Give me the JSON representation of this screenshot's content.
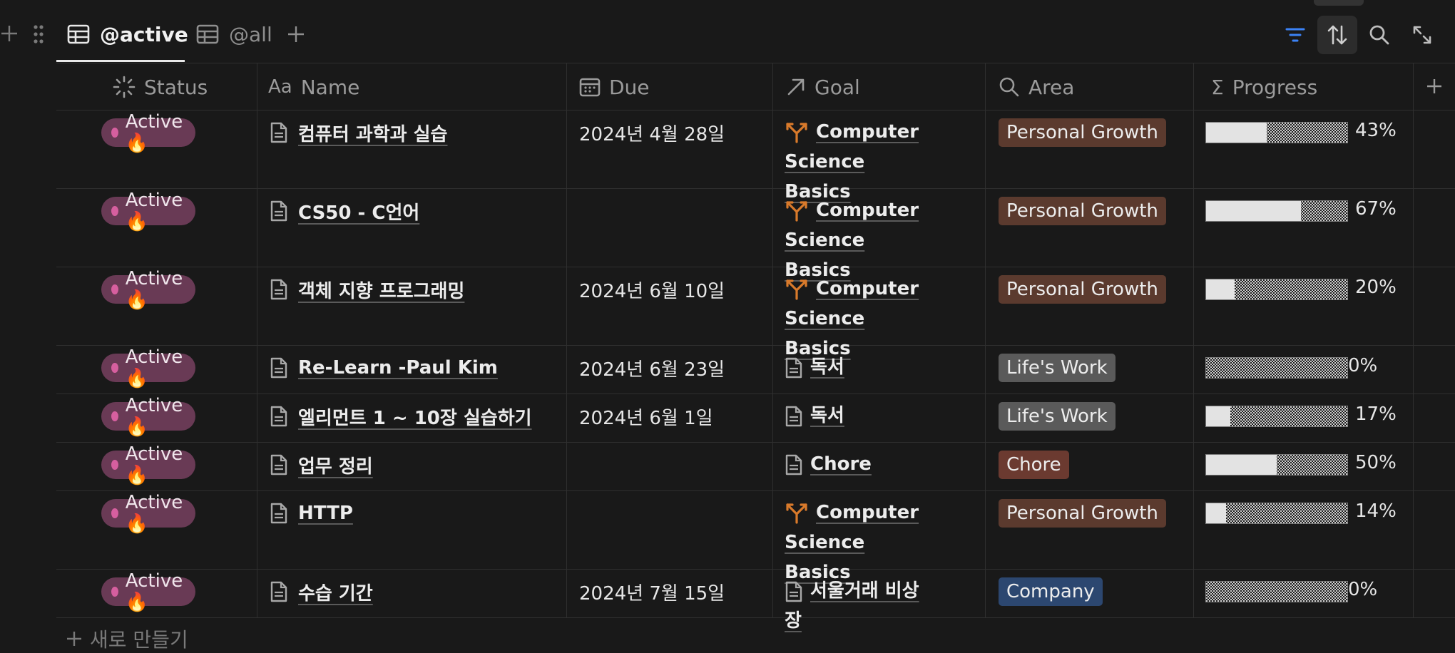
{
  "tabs": [
    {
      "label": "@active",
      "active": true
    },
    {
      "label": "@all",
      "active": false
    }
  ],
  "toolbar": {
    "filter_color": "#3b82f6"
  },
  "columns": [
    {
      "label": "Status",
      "icon": "status-icon"
    },
    {
      "label": "Name",
      "icon": "text-prop-icon",
      "icon_text": "Aa"
    },
    {
      "label": "Due",
      "icon": "calendar-icon"
    },
    {
      "label": "Goal",
      "icon": "relation-arrow-icon"
    },
    {
      "label": "Area",
      "icon": "search-icon"
    },
    {
      "label": "Progress",
      "icon": "sigma-icon",
      "icon_text": "Σ"
    }
  ],
  "status_label": "Active 🔥",
  "rows": [
    {
      "status": "Active 🔥",
      "name": "컴퓨터 과학과 실습",
      "due": "2024년 4월 28일",
      "goal": "Computer Science Basics",
      "goal_line1": "Computer",
      "goal_line2": "Science Basics",
      "goal_icon": "goal-icon",
      "area": "Personal Growth",
      "area_color": "#5b3a2e",
      "progress": 0.43,
      "progress_label": "43%"
    },
    {
      "status": "Active 🔥",
      "name": "CS50 - C언어",
      "due": "",
      "goal": "Computer Science Basics",
      "goal_line1": "Computer",
      "goal_line2": "Science Basics",
      "goal_icon": "goal-icon",
      "area": "Personal Growth",
      "area_color": "#5b3a2e",
      "progress": 0.67,
      "progress_label": "67%"
    },
    {
      "status": "Active 🔥",
      "name": "객체 지향 프로그래밍",
      "due": "2024년 6월 10일",
      "goal": "Computer Science Basics",
      "goal_line1": "Computer",
      "goal_line2": "Science Basics",
      "goal_icon": "goal-icon",
      "area": "Personal Growth",
      "area_color": "#5b3a2e",
      "progress": 0.2,
      "progress_label": "20%"
    },
    {
      "status": "Active 🔥",
      "name": "Re-Learn -Paul Kim",
      "due": "2024년 6월 23일",
      "goal": "독서",
      "goal_line1": "독서",
      "goal_line2": "",
      "goal_icon": "page-icon",
      "area": "Life's Work",
      "area_color": "#5a5a5a",
      "progress": 0.0,
      "progress_label": "0%"
    },
    {
      "status": "Active 🔥",
      "name": "엘리먼트 1 ~ 10장 실습하기",
      "due": "2024년 6월 1일",
      "goal": "독서",
      "goal_line1": "독서",
      "goal_line2": "",
      "goal_icon": "page-icon",
      "area": "Life's Work",
      "area_color": "#5a5a5a",
      "progress": 0.17,
      "progress_label": "17%"
    },
    {
      "status": "Active 🔥",
      "name": "업무 정리",
      "due": "",
      "goal": "Chore",
      "goal_line1": "Chore",
      "goal_line2": "",
      "goal_icon": "page-icon",
      "area": "Chore",
      "area_color": "#6b3a30",
      "progress": 0.5,
      "progress_label": "50%"
    },
    {
      "status": "Active 🔥",
      "name": "HTTP",
      "due": "",
      "goal": "Computer Science Basics",
      "goal_line1": "Computer",
      "goal_line2": "Science Basics",
      "goal_icon": "goal-icon",
      "area": "Personal Growth",
      "area_color": "#5b3a2e",
      "progress": 0.14,
      "progress_label": "14%"
    },
    {
      "status": "Active 🔥",
      "name": "수습 기간",
      "due": "2024년 7월 15일",
      "goal": "서울거래 비상장",
      "goal_line1": "서울거래 비상장",
      "goal_line2": "",
      "goal_icon": "page-icon",
      "area": "Company",
      "area_color": "#2c4770",
      "progress": 0.0,
      "progress_label": "0%"
    }
  ],
  "new_row_label": "새로 만들기"
}
